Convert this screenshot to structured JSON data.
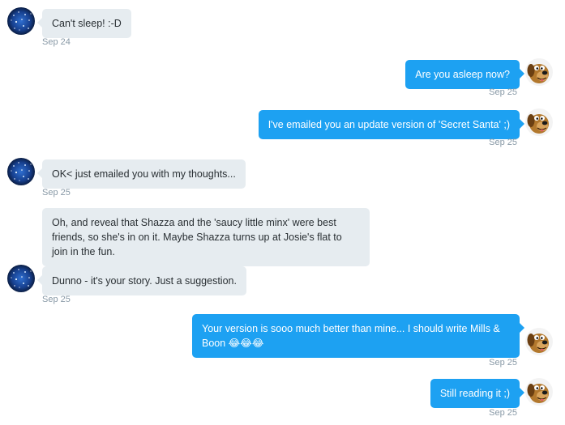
{
  "conversation": {
    "messages": [
      {
        "direction": "incoming",
        "text": "Can't sleep! :-D",
        "time": "Sep 24"
      },
      {
        "direction": "outgoing",
        "text": "Are you asleep now?",
        "time": "Sep 25"
      },
      {
        "direction": "outgoing",
        "text": "I've emailed you an update version of 'Secret Santa' ;)",
        "time": "Sep 25"
      },
      {
        "direction": "incoming",
        "text": "OK< just emailed you with my thoughts...",
        "time": "Sep 25"
      },
      {
        "direction": "incoming",
        "text": "Oh, and reveal that Shazza and the 'saucy little minx' were best friends, so she's in on it. Maybe Shazza turns up at Josie's flat to join in the fun."
      },
      {
        "direction": "incoming",
        "text": "Dunno - it's your story. Just a suggestion.",
        "time": "Sep 25"
      },
      {
        "direction": "outgoing",
        "text": "Your version is sooo much better than mine... I should write Mills & Boon 😂😂😂",
        "time": "Sep 25"
      },
      {
        "direction": "outgoing",
        "text": "Still reading it ;)",
        "time": "Sep 25"
      }
    ]
  },
  "avatars": {
    "incoming_icon": "starfield-avatar-icon",
    "outgoing_icon": "cartoon-dog-avatar-icon"
  },
  "colors": {
    "incoming_bubble": "#e6ecf0",
    "outgoing_bubble": "#1da1f2",
    "timestamp": "#8899a6"
  }
}
